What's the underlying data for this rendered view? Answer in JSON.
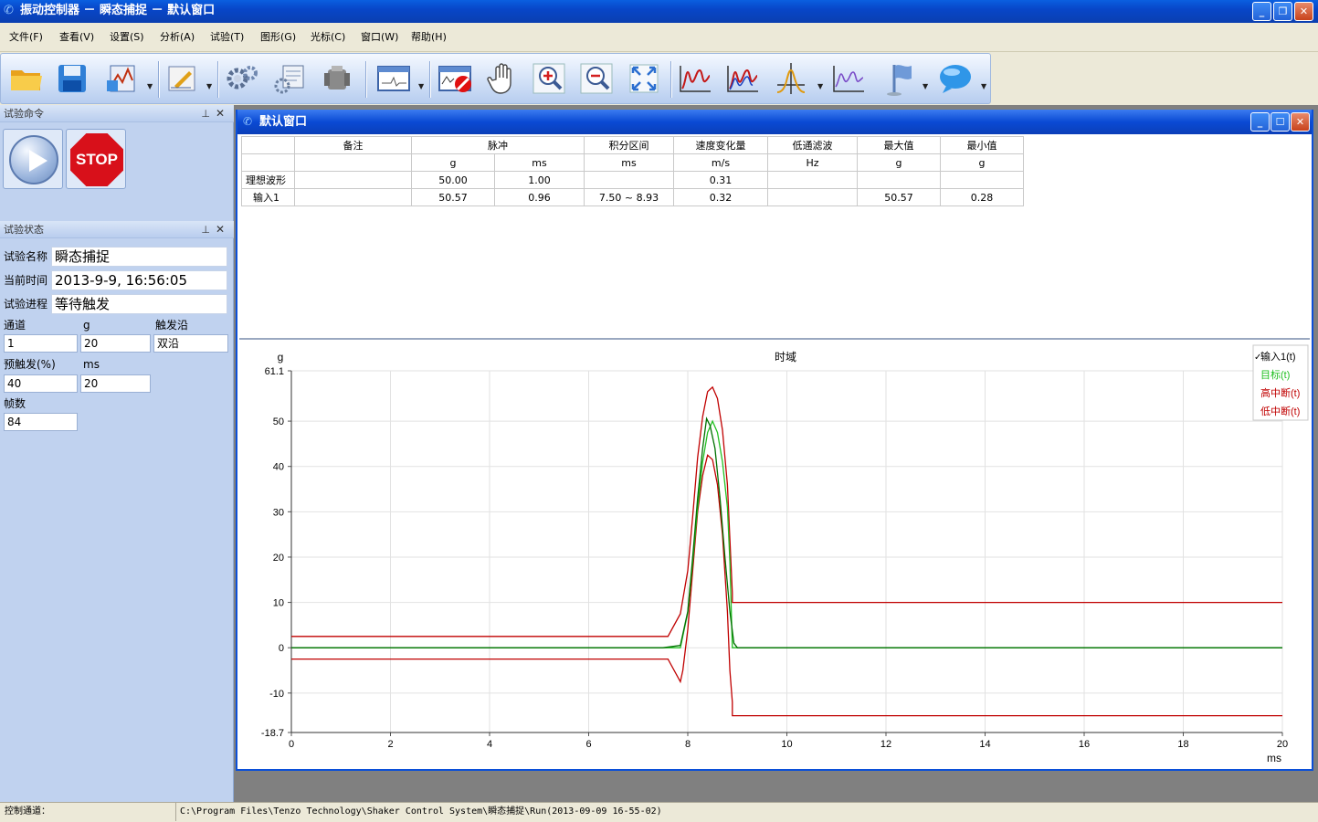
{
  "window": {
    "title": "振动控制器 － 瞬态捕捉 － 默认窗口"
  },
  "menu": [
    "文件(F)",
    "查看(V)",
    "设置(S)",
    "分析(A)",
    "试验(T)",
    "图形(G)",
    "光标(C)",
    "窗口(W)",
    "帮助(H)"
  ],
  "toolbar": {
    "icons": [
      "open-folder-icon",
      "save-icon",
      "run-chart-icon",
      "edit-icon",
      "settings-gears-icon",
      "parameters-icon",
      "equipment-icon",
      "waveform-window-icon",
      "delete-chart-icon",
      "pan-hand-icon",
      "zoom-in-icon",
      "zoom-out-icon",
      "fit-view-icon",
      "spectrum-icon",
      "spectrum-multi-icon",
      "cursor-peak-icon",
      "overlay-curve-icon",
      "marker-flag-icon",
      "comment-bubble-icon"
    ]
  },
  "test_command": {
    "title": "试验命令",
    "stop_label": "STOP"
  },
  "test_status": {
    "title": "试验状态",
    "name_label": "试验名称",
    "name_value": "瞬态捕捉",
    "time_label": "当前时间",
    "time_value": "2013-9-9, 16:56:05",
    "progress_label": "试验进程",
    "progress_value": "等待触发",
    "channel_label": "通道",
    "channel_value": "1",
    "g_label": "g",
    "g_value": "20",
    "edge_label": "触发沿",
    "edge_value": "双沿",
    "pretrigger_label": "预触发(%)",
    "pretrigger_value": "40",
    "ms_label": "ms",
    "ms_value": "20",
    "frames_label": "帧数",
    "frames_value": "84"
  },
  "child_window": {
    "title": "默认窗口"
  },
  "result_table": {
    "headers": [
      "",
      "备注",
      "脉冲",
      "",
      "积分区间",
      "速度变化量",
      "低通滤波",
      "最大值",
      "最小值"
    ],
    "units": [
      "",
      "",
      "g",
      "ms",
      "ms",
      "m/s",
      "Hz",
      "g",
      "g"
    ],
    "rows": [
      [
        "理想波形",
        "",
        "50.00",
        "1.00",
        "",
        "0.31",
        "",
        "",
        ""
      ],
      [
        "输入1",
        "",
        "50.57",
        "0.96",
        "7.50 ~ 8.93",
        "0.32",
        "",
        "50.57",
        "0.28"
      ]
    ]
  },
  "chart_data": {
    "type": "line",
    "title": "时域",
    "ylabel": "g",
    "xlabel": "ms",
    "xlim": [
      0,
      20
    ],
    "ylim": [
      -18.7,
      61.1
    ],
    "x_ticks": [
      0,
      2,
      4,
      6,
      8,
      10,
      12,
      14,
      16,
      18,
      20
    ],
    "y_ticks": [
      "61.1",
      "50",
      "40",
      "30",
      "20",
      "10",
      "0",
      "-10",
      "-18.7"
    ],
    "y_tick_values": [
      61.1,
      50,
      40,
      30,
      20,
      10,
      0,
      -10,
      -18.7
    ],
    "grid": true,
    "legend_position": "top-right",
    "series": [
      {
        "name": "输入1(t)",
        "color": "#007000",
        "checked": true,
        "x": [
          0,
          7.5,
          7.85,
          8.0,
          8.1,
          8.2,
          8.3,
          8.38,
          8.45,
          8.55,
          8.65,
          8.75,
          8.85,
          8.93,
          9.0,
          20
        ],
        "y": [
          0,
          0,
          0.5,
          8,
          20,
          33,
          44,
          50.57,
          49,
          44,
          33,
          20,
          8,
          1,
          0,
          0
        ]
      },
      {
        "name": "目标(t)",
        "color": "#22c022",
        "x": [
          0,
          7.5,
          7.85,
          8.0,
          8.1,
          8.2,
          8.3,
          8.4,
          8.5,
          8.6,
          8.7,
          8.8,
          8.85,
          8.9,
          20
        ],
        "y": [
          0,
          0,
          0,
          7.8,
          19,
          31,
          41,
          47.5,
          50,
          47.5,
          41,
          31,
          19,
          0,
          0
        ]
      },
      {
        "name": "高中断(t)",
        "color": "#c00000",
        "x": [
          0,
          7.6,
          7.85,
          8.0,
          8.1,
          8.2,
          8.3,
          8.4,
          8.5,
          8.6,
          8.7,
          8.8,
          8.85,
          8.9,
          8.9,
          20
        ],
        "y": [
          2.5,
          2.5,
          7.5,
          17,
          29,
          42,
          51,
          56.5,
          57.5,
          55,
          48,
          36,
          24,
          12,
          10,
          10
        ]
      },
      {
        "name": "低中断(t)",
        "color": "#c00000",
        "x": [
          0,
          7.6,
          7.85,
          7.9,
          8.0,
          8.1,
          8.2,
          8.3,
          8.4,
          8.5,
          8.6,
          8.7,
          8.8,
          8.85,
          8.9,
          8.9,
          20
        ],
        "y": [
          -2.5,
          -2.5,
          -7.5,
          -5,
          4,
          17,
          30,
          38,
          42.5,
          41.5,
          36,
          25,
          8,
          -5,
          -12,
          -15,
          -15
        ]
      }
    ]
  },
  "statusbar": {
    "channel_label": "控制通道：",
    "path": "C:\\Program Files\\Tenzo Technology\\Shaker Control System\\瞬态捕捉\\Run(2013-09-09 16-55-02)"
  }
}
